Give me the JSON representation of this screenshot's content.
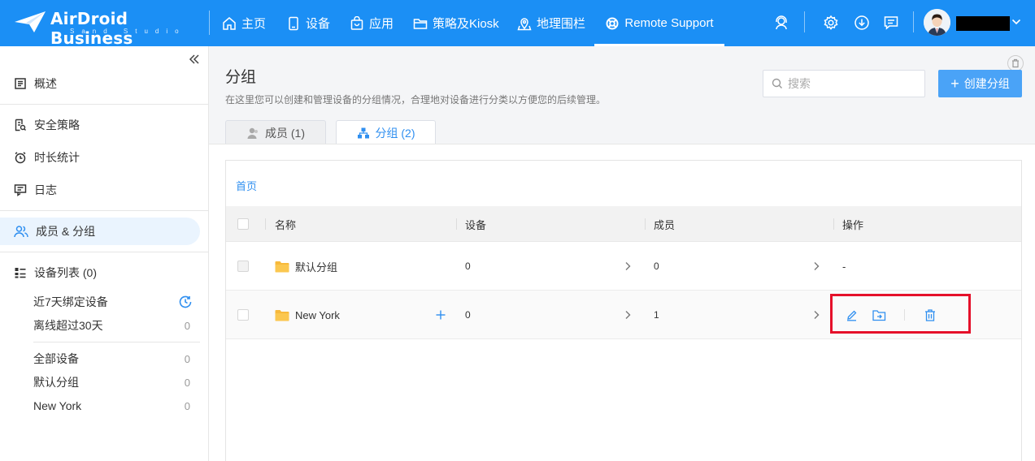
{
  "app": {
    "brand_name": "AirDroid Business",
    "brand_sub": "Sand Studio"
  },
  "nav": {
    "items": [
      {
        "label": "主页",
        "icon": "home-icon"
      },
      {
        "label": "设备",
        "icon": "device-icon"
      },
      {
        "label": "应用",
        "icon": "app-bag-icon"
      },
      {
        "label": "策略及Kiosk",
        "icon": "folder-icon"
      },
      {
        "label": "地理围栏",
        "icon": "map-pin-icon"
      },
      {
        "label": "Remote Support",
        "icon": "lifebuoy-icon",
        "active": true
      }
    ]
  },
  "sidebar": {
    "items": [
      {
        "label": "概述",
        "icon": "overview-icon"
      },
      {
        "label": "安全策略",
        "icon": "policy-icon"
      },
      {
        "label": "时长统计",
        "icon": "alarm-clock-icon"
      },
      {
        "label": "日志",
        "icon": "log-icon"
      },
      {
        "label": "成员 & 分组",
        "icon": "users-icon",
        "active": true
      },
      {
        "label": "设备列表 (0)",
        "icon": "device-list-icon"
      }
    ],
    "device_filters": [
      {
        "label": "近7天绑定设备",
        "count": ""
      },
      {
        "label": "离线超过30天",
        "count": "0"
      }
    ],
    "groups": [
      {
        "label": "全部设备",
        "count": "0"
      },
      {
        "label": "默认分组",
        "count": "0"
      },
      {
        "label": "New York",
        "count": "0"
      }
    ]
  },
  "main": {
    "title": "分组",
    "description": "在这里您可以创建和管理设备的分组情况，合理地对设备进行分类以方便您的后续管理。",
    "search_placeholder": "搜索",
    "create_label": "创建分组",
    "tabs": [
      {
        "label": "成员 (1)",
        "icon": "member-icon"
      },
      {
        "label": "分组 (2)",
        "icon": "group-tree-icon",
        "selected": true
      }
    ],
    "breadcrumb": "首页",
    "table": {
      "headers": [
        "名称",
        "设备",
        "成员",
        "操作"
      ],
      "rows": [
        {
          "name": "默认分组",
          "devices": "0",
          "members": "0",
          "actions": "-"
        },
        {
          "name": "New York",
          "devices": "0",
          "members": "1",
          "actions": ""
        }
      ]
    }
  },
  "colors": {
    "brand": "#1b8ff5",
    "link": "#2f8ff0",
    "highlight": "#e5102a",
    "folder": "#f7b93b"
  }
}
